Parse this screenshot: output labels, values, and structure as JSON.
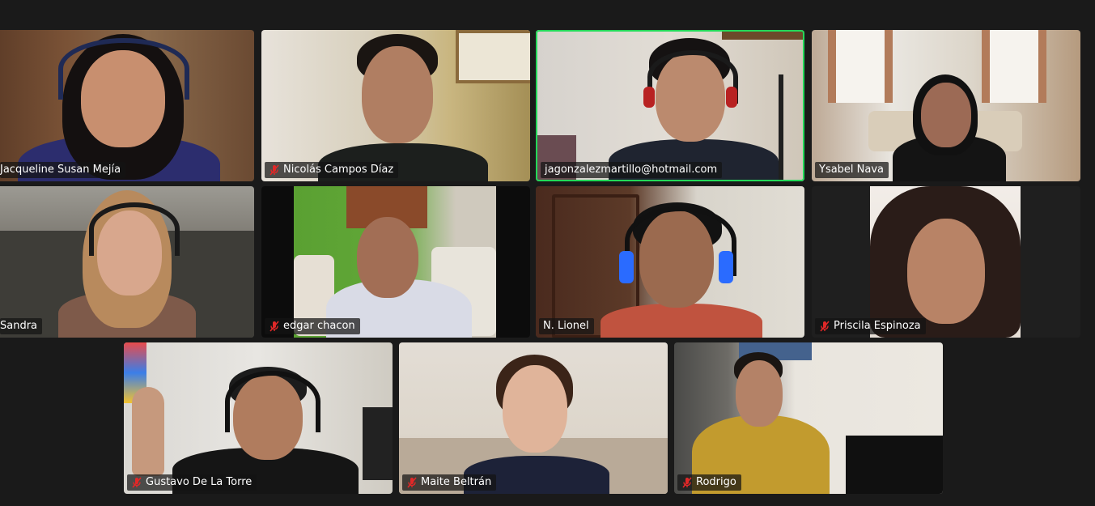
{
  "meeting": {
    "participants": [
      {
        "name": "Jacqueline Susan Mejía",
        "muted": false,
        "active": false
      },
      {
        "name": "Nicolás Campos Díaz",
        "muted": true,
        "active": false
      },
      {
        "name": "jagonzalezmartillo@hotmail.com",
        "muted": false,
        "active": true
      },
      {
        "name": "Ysabel Nava",
        "muted": false,
        "active": false
      },
      {
        "name": "Sandra",
        "muted": false,
        "active": false
      },
      {
        "name": "edgar chacon",
        "muted": true,
        "active": false
      },
      {
        "name": "N. Lionel",
        "muted": false,
        "active": false
      },
      {
        "name": "Priscila Espinoza",
        "muted": true,
        "active": false
      },
      {
        "name": "Gustavo De La Torre",
        "muted": true,
        "active": false
      },
      {
        "name": "Maite Beltrán",
        "muted": true,
        "active": false
      },
      {
        "name": "Rodrigo",
        "muted": true,
        "active": false
      }
    ]
  },
  "icons": {
    "muted": "microphone-muted-icon"
  },
  "colors": {
    "background": "#1a1a1a",
    "active_speaker": "#23d959",
    "muted_icon": "#e02828",
    "name_text": "#ffffff"
  }
}
